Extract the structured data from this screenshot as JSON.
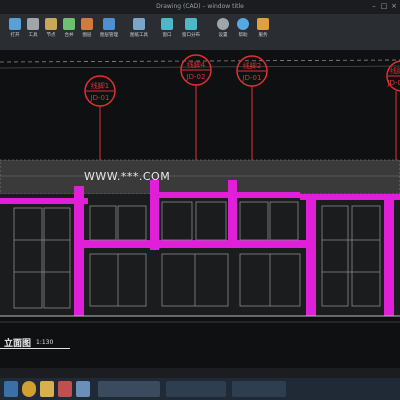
{
  "titlebar": {
    "title": "Drawing (CAD) – window title"
  },
  "ribbon": {
    "tools": [
      {
        "label": "打开",
        "color": "#5aa0d8",
        "icon": "open-icon"
      },
      {
        "label": "工具",
        "color": "#9ea5ab",
        "icon": "tool-icon"
      },
      {
        "label": "节点",
        "color": "#c8a85a",
        "icon": "node-icon"
      },
      {
        "label": "合并",
        "color": "#6cc070",
        "icon": "merge-icon"
      },
      {
        "label": "图层",
        "color": "#d07a40",
        "icon": "layer-icon"
      },
      {
        "label": "图层管理",
        "color": "#4f8fd0",
        "icon": "layer-manager-icon"
      },
      {
        "label": "图纸工具",
        "color": "#7aa6c8",
        "icon": "drawing-tool-icon"
      },
      {
        "label": "窗口",
        "color": "#4fb8c8",
        "icon": "window-icon"
      },
      {
        "label": "窗口分布",
        "color": "#4fb8c8",
        "icon": "window-layout-icon"
      },
      {
        "label": "设置",
        "color": "#9ea5ab",
        "icon": "settings-icon"
      },
      {
        "label": "帮助",
        "color": "#56a8e0",
        "icon": "help-icon"
      },
      {
        "label": "服务",
        "color": "#e0a040",
        "icon": "service-icon"
      }
    ]
  },
  "drawing": {
    "callouts": [
      {
        "name": "线脚1",
        "code": "JD-01"
      },
      {
        "name": "线脚4",
        "code": "JD-02"
      },
      {
        "name": "线脚2",
        "code": "JD-01"
      },
      {
        "name": "线脚",
        "code": "JD-01"
      }
    ],
    "watermark": "WWW.***.COM",
    "view_title": "立面图",
    "scale": "1:130"
  },
  "colors": {
    "background": "#0e1012",
    "magenta": "#e020d8",
    "callout_red": "#e23030",
    "ribbon": "#2a2d31"
  }
}
